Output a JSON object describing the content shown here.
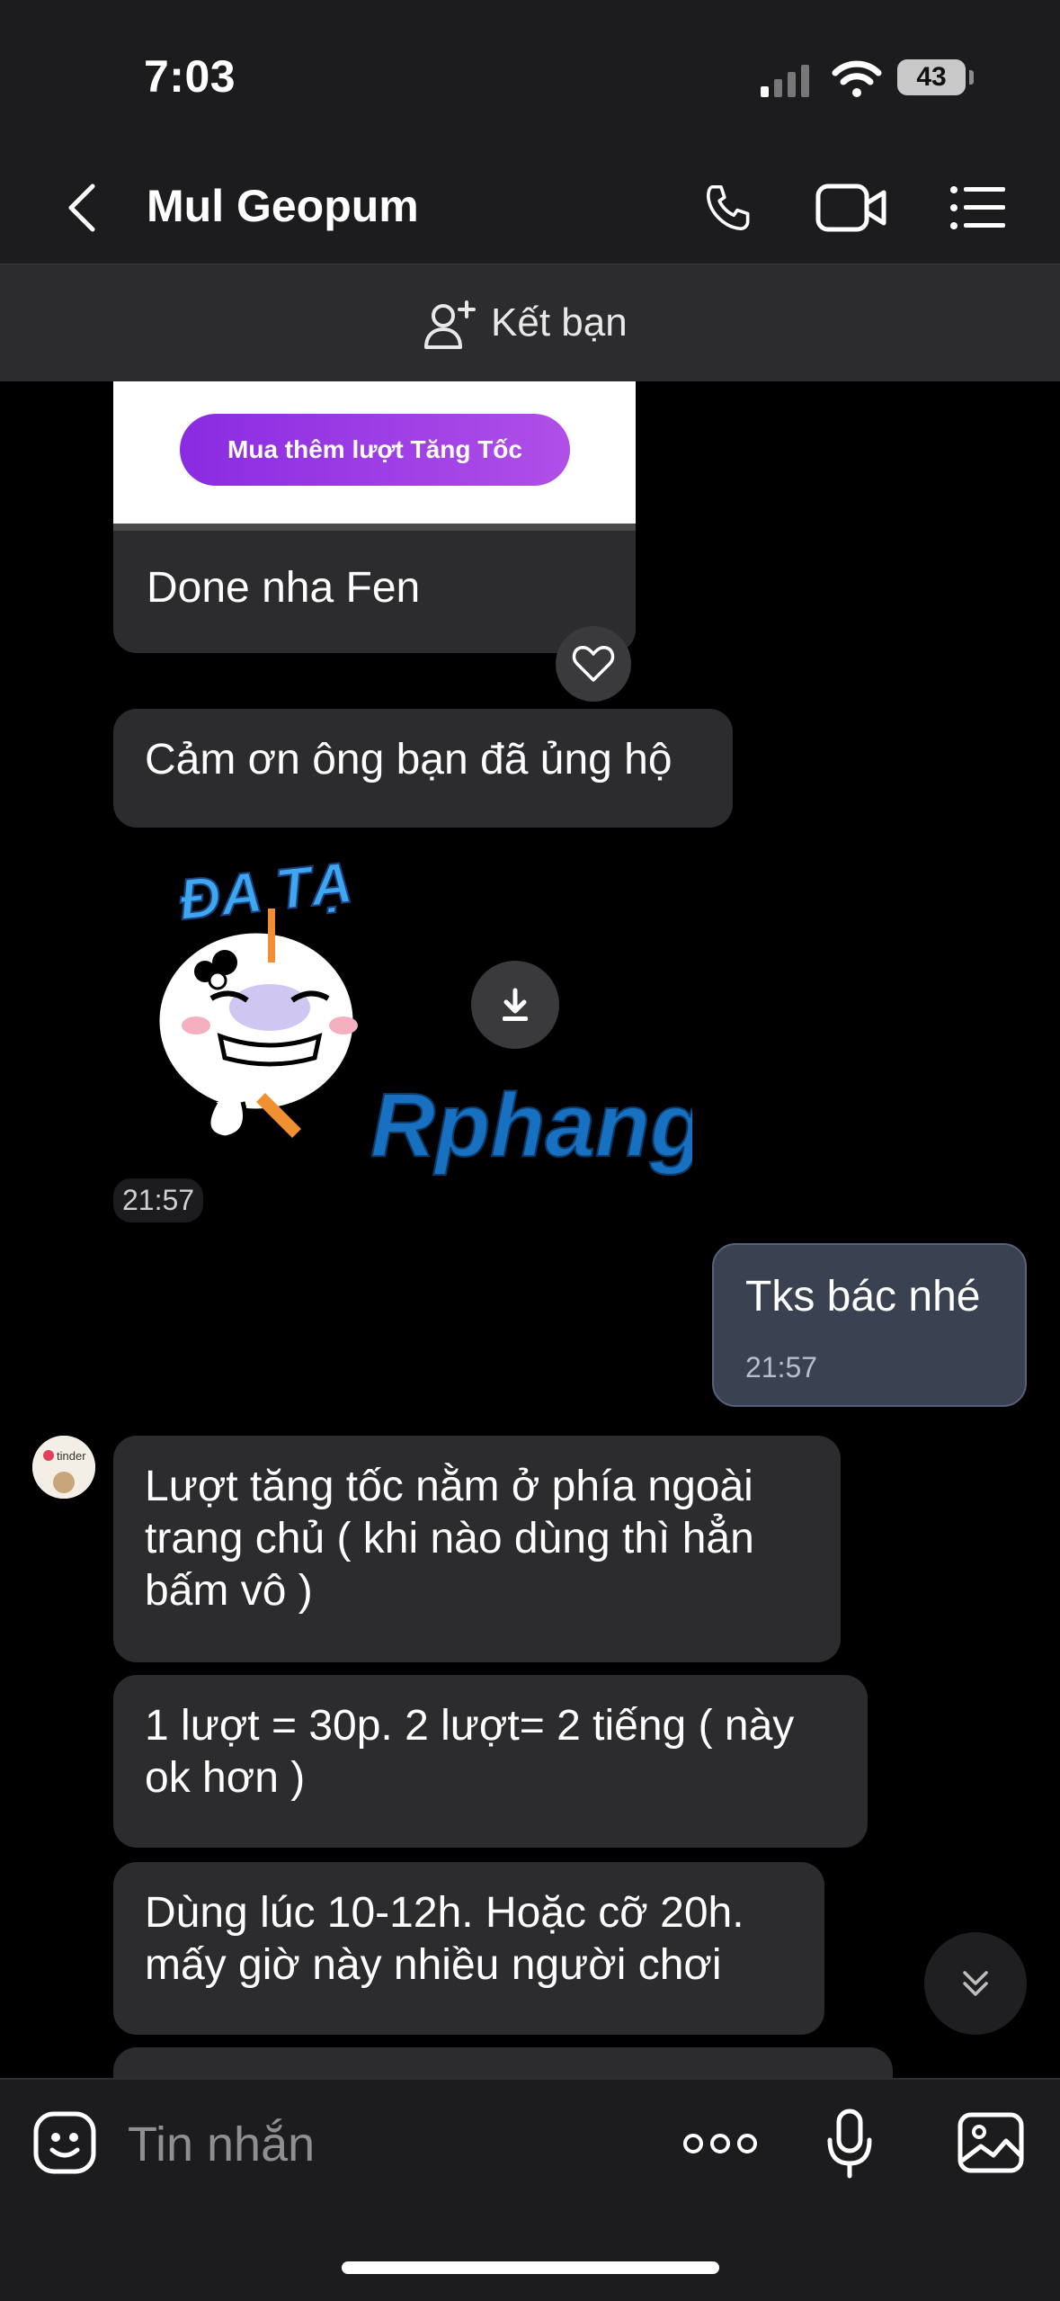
{
  "status_bar": {
    "time": "7:03",
    "battery": "43"
  },
  "header": {
    "contact_name": "Mul Geopum"
  },
  "friend_bar": {
    "label": "Kết bạn"
  },
  "messages": {
    "promo_button": "Mua thêm lượt Tăng Tốc",
    "promo_caption": "Done nha Fen",
    "thanks": "Cảm ơn ông bạn đã ủng hộ",
    "sticker": {
      "title": "ĐA TẠ",
      "watermark": "Rphang",
      "time": "21:57"
    },
    "outgoing": {
      "text": "Tks bác nhé",
      "time": "21:57"
    },
    "m1": "Lượt tăng tốc nằm ở phía ngoài trang chủ ( khi nào dùng thì hẳn bấm vô )",
    "m2": "1 lượt = 30p. 2 lượt= 2 tiếng ( này ok hơn )",
    "m3": "Dùng lúc 10-12h. Hoặc cỡ 20h. mấy giờ này nhiều người chơi"
  },
  "avatar": {
    "label": "tinder"
  },
  "composer": {
    "placeholder": "Tin nhắn"
  },
  "colors": {
    "bubble_in": "#2c2c2e",
    "bubble_out": "#3a4150",
    "bg": "#000000"
  }
}
